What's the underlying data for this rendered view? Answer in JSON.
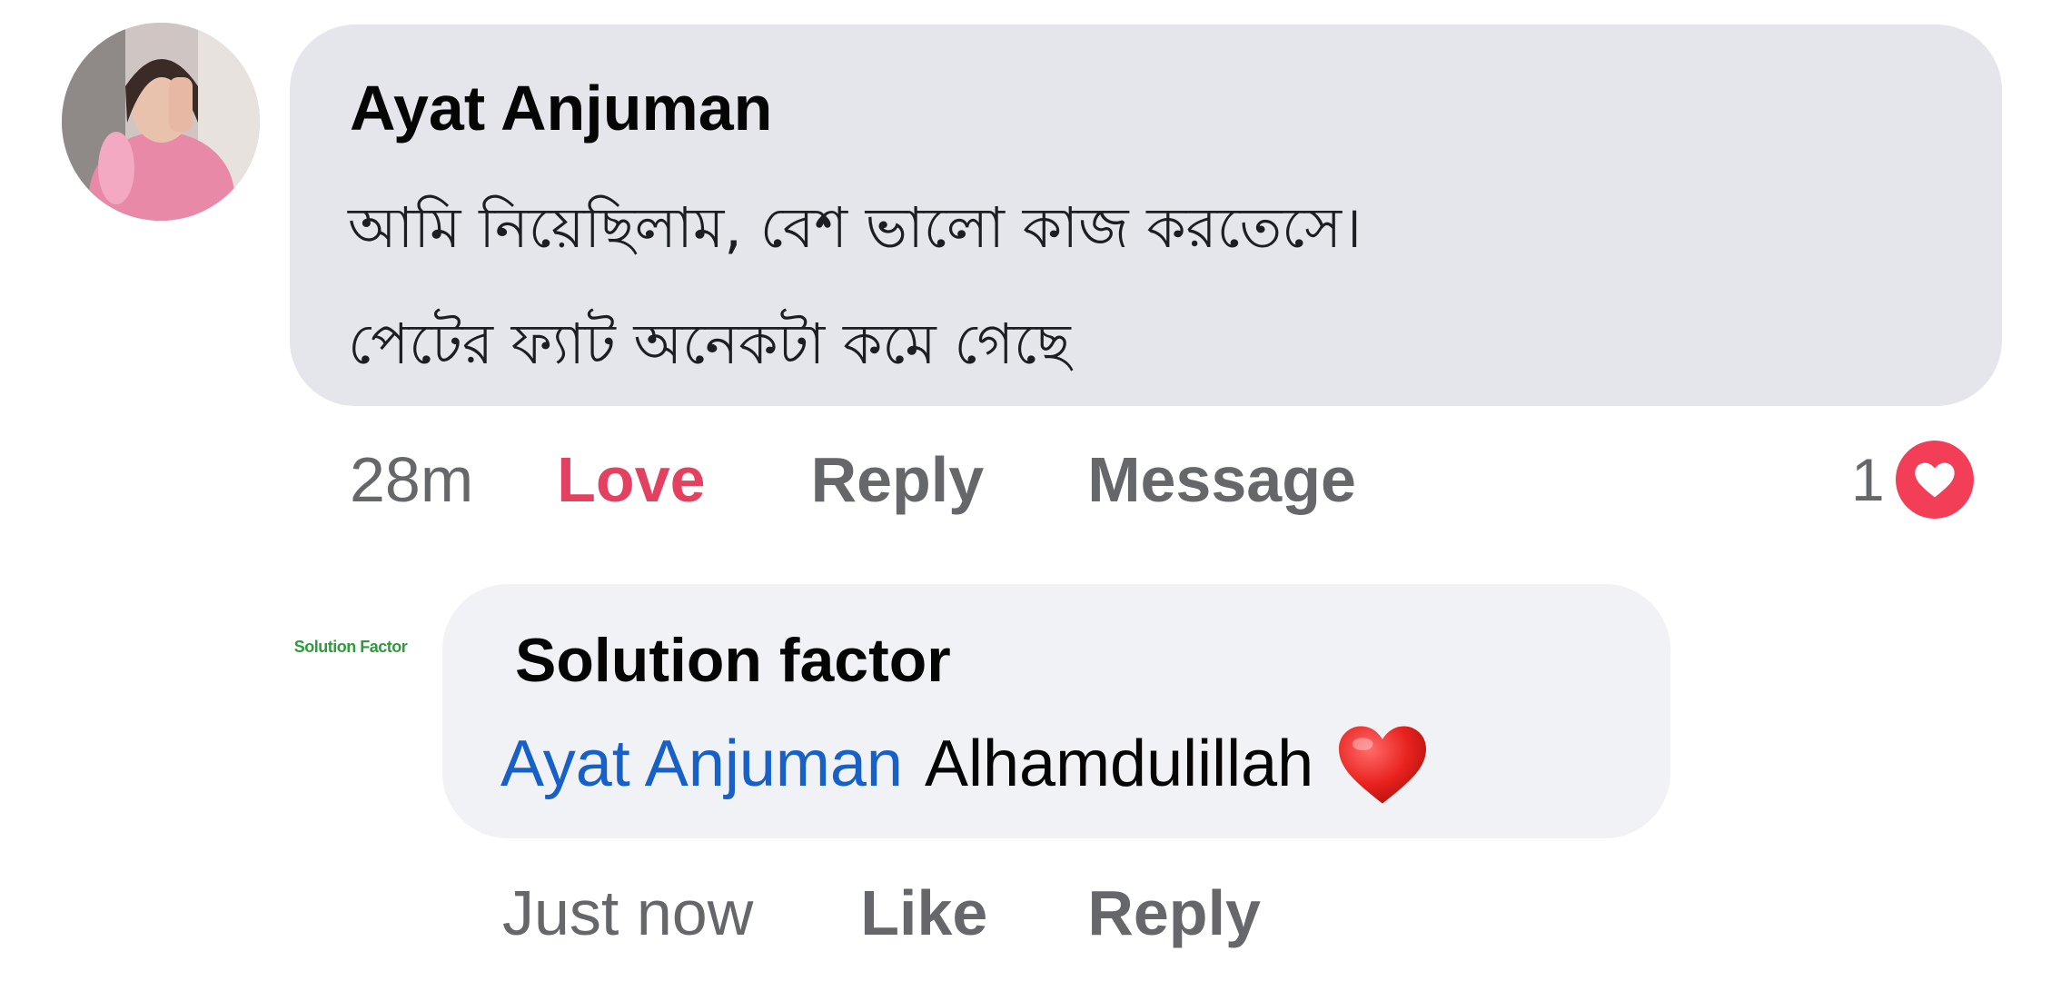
{
  "comment": {
    "author": "Ayat Anjuman",
    "text_line_1": "আমি নিয়েছিলাম, বেশ ভালো কাজ করতেসে।",
    "text_line_2": "পেটের ফ্যাট অনেকটা কমে গেছে",
    "timestamp": "28m",
    "love_label": "Love",
    "reply_label": "Reply",
    "message_label": "Message",
    "reaction_count": "1",
    "reaction_icon": "heart-icon",
    "reaction_color": "#f33e58",
    "love_color": "#e4405f"
  },
  "reply": {
    "avatar_logo_text": "Solution Factor",
    "author": "Solution factor",
    "mention": "Ayat Anjuman",
    "text": "Alhamdulillah",
    "emoji": "red-heart-emoji",
    "timestamp": "Just now",
    "like_label": "Like",
    "reply_label": "Reply",
    "mention_color": "#1760c8"
  },
  "colors": {
    "bubble_primary": "#e4e6eb",
    "bubble_reply": "#f0f2f5",
    "secondary_text": "#65676b"
  }
}
